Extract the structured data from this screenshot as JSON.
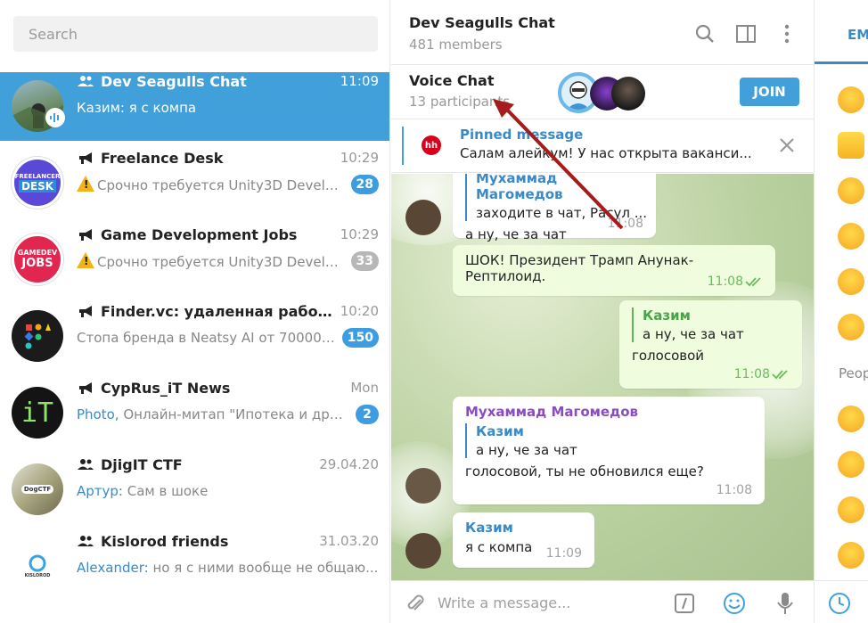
{
  "search": {
    "placeholder": "Search"
  },
  "chats": [
    {
      "title": "Dev Seagulls Chat",
      "time": "11:09",
      "sender": "Казим: ",
      "preview": "я с компа",
      "type": "group",
      "badge": "",
      "active": true
    },
    {
      "title": "Freelance Desk",
      "time": "10:29",
      "sender": "",
      "preview": "Срочно требуется Unity3D Develo...",
      "type": "channel",
      "badge": "28",
      "warn": true
    },
    {
      "title": "Game Development Jobs",
      "time": "10:29",
      "sender": "",
      "preview": "Срочно требуется Unity3D Develo...",
      "type": "channel",
      "badge": "33",
      "warn": true,
      "muted": true
    },
    {
      "title": "Finder.vc: удаленная работа - ва...",
      "time": "10:20",
      "sender": "",
      "preview": "Стопа бренда в Neatsy AI от 70000 д...",
      "type": "channel",
      "badge": "150"
    },
    {
      "title": "CypRus_iT News",
      "time": "Mon",
      "sender": "Photo, ",
      "preview": "Онлайн-митап \"Ипотека и друг...",
      "type": "channel",
      "badge": "2"
    },
    {
      "title": "DjigIT CTF",
      "time": "29.04.20",
      "sender": "Артур: ",
      "preview": "Сам в шоке",
      "type": "group",
      "badge": ""
    },
    {
      "title": "Kislorod friends",
      "time": "31.03.20",
      "sender": "Alexander: ",
      "preview": "но я с ними вообще не общаю...",
      "type": "group",
      "badge": ""
    }
  ],
  "avatars": {
    "freelance": [
      "FREELANCER",
      "DESK"
    ],
    "gamedev": [
      "GAMEDEV",
      "JOBS"
    ],
    "cyprus": "iT",
    "djigit": "DogCTF",
    "kislorod": "KISLOROD"
  },
  "header": {
    "title": "Dev Seagulls Chat",
    "subtitle": "481 members"
  },
  "voice_chat": {
    "title": "Voice Chat",
    "subtitle": "13 participants",
    "join_label": "JOIN"
  },
  "pinned": {
    "title": "Pinned message",
    "text": "Салам алейкум!  У нас открыта ваканси...",
    "logo": "hh"
  },
  "messages": [
    {
      "quote_author": "Мухаммад Магомедов",
      "quote_text": "заходите в чат, Расул ...",
      "text": "а ну, че за чат",
      "time": "11:08"
    },
    {
      "text": "ШОК! Президент Трамп Анунак-Рептилоид.",
      "time": "11:08",
      "out": true
    },
    {
      "quote_author": "Казим",
      "quote_text": "а ну, че за чат",
      "text": "голосовой",
      "time": "11:08",
      "out": true
    },
    {
      "author": "Мухаммад Магомедов",
      "quote_author": "Казим",
      "quote_text": "а ну, че за чат",
      "text": "голосовой, ты не обновился еще?",
      "time": "11:08"
    },
    {
      "author": "Казим",
      "text": "я с компа",
      "time": "11:09"
    }
  ],
  "composer": {
    "placeholder": "Write a message..."
  },
  "emoji_panel": {
    "tab_label": "EM",
    "section_label": "Peop"
  },
  "colors": {
    "accent": "#419fd9",
    "link": "#3b8ac8",
    "badge": "#3e9de0",
    "outgoing": "#effdde",
    "author_purple": "#8a4cbf",
    "arrow": "#a61b1b"
  }
}
